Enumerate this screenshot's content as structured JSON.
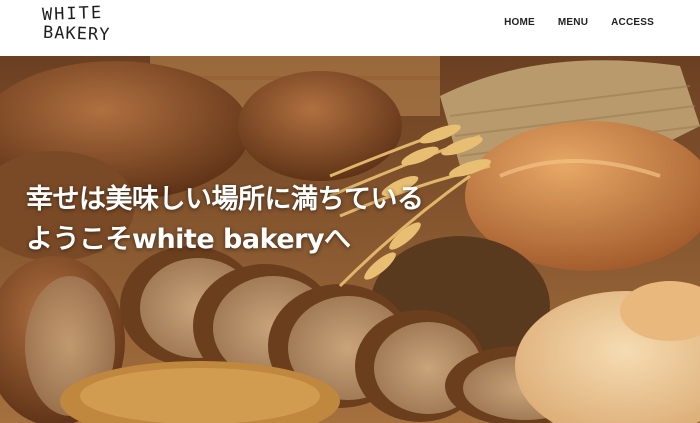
{
  "header": {
    "logo": {
      "line1": "WHITE",
      "line2": "BAKERY"
    },
    "nav": [
      {
        "label": "HOME"
      },
      {
        "label": "MENU"
      },
      {
        "label": "ACCESS"
      }
    ]
  },
  "hero": {
    "headline_line1": "幸せは美味しい場所に満ちている",
    "headline_line2": "ようこそwhite bakeryへ"
  }
}
